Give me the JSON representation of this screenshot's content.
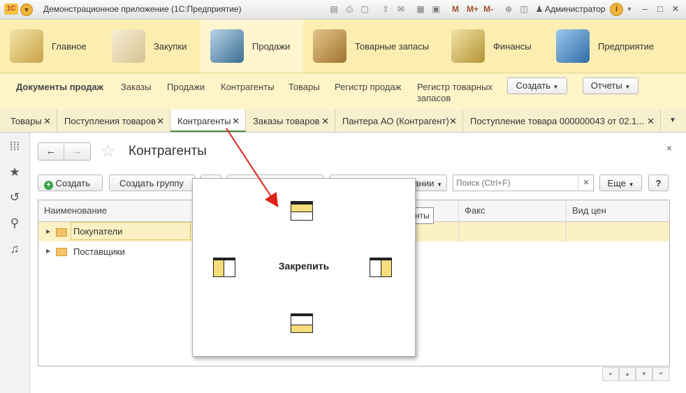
{
  "window": {
    "title": "Демонстрационное приложение  (1С:Предприятие)",
    "logo": "1С",
    "user": "Администратор",
    "toolbar_letters": [
      "M",
      "M+",
      "M-"
    ]
  },
  "sections": [
    {
      "label": "Главное",
      "icon": "desk-lamp-icon",
      "active": false
    },
    {
      "label": "Закупки",
      "icon": "shopping-bag-icon",
      "active": false
    },
    {
      "label": "Продажи",
      "icon": "cash-register-icon",
      "active": true
    },
    {
      "label": "Товарные запасы",
      "icon": "box-icon",
      "active": false
    },
    {
      "label": "Финансы",
      "icon": "coins-icon",
      "active": false
    },
    {
      "label": "Предприятие",
      "icon": "building-icon",
      "active": false
    }
  ],
  "subnav": {
    "title": "Документы продаж",
    "links": [
      "Заказы",
      "Продажи",
      "Контрагенты",
      "Товары",
      "Регистр продаж",
      "Регистр товарных",
      "запасов"
    ],
    "create_label": "Создать",
    "reports_label": "Отчеты"
  },
  "tabs": [
    {
      "label": "Товары"
    },
    {
      "label": "Поступления товаров"
    },
    {
      "label": "Контрагенты",
      "active": true
    },
    {
      "label": "Заказы товаров"
    },
    {
      "label": "Пантера АО (Контрагент)"
    },
    {
      "label": "Поступление товара 000000043 от 02.1..."
    }
  ],
  "form": {
    "title": "Контрагенты",
    "create_label": "Создать",
    "create_group_label": "Создать группу",
    "hidden_menu_tail": "ании",
    "search_placeholder": "Поиск (Ctrl+F)",
    "more_label": "Еще",
    "help_label": "?",
    "close_label": "×"
  },
  "grid": {
    "columns": [
      "Наименование",
      "Факс",
      "Вид цен"
    ],
    "rows": [
      "Покупатели",
      "Поставщики"
    ]
  },
  "popup": {
    "label": "Закрепить"
  },
  "tooltip": "Контрагенты",
  "colors": {
    "sections_bg": "#fbeeb0",
    "accent_green": "#4a8a3c",
    "row_highlight": "#fbf1c4",
    "arrow_red": "#e0221c"
  }
}
